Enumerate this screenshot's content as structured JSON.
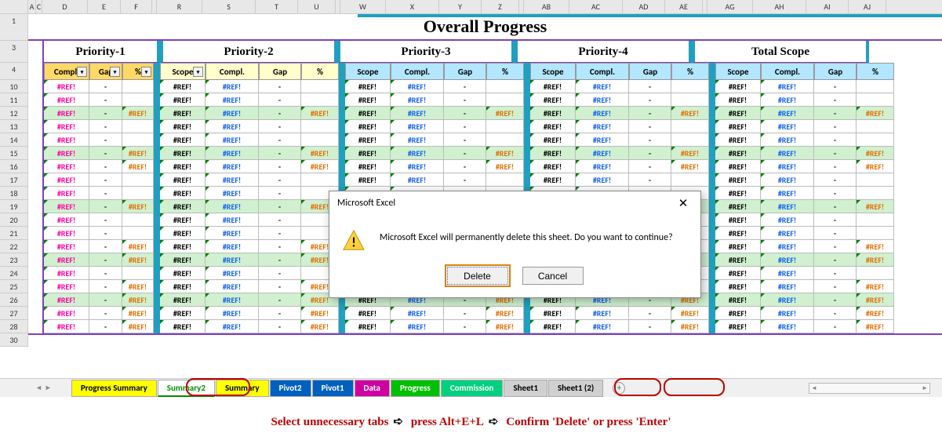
{
  "title": "Overall Progress",
  "sections": [
    "Priority-1",
    "Priority-2",
    "Priority-3",
    "Priority-4",
    "Total Scope"
  ],
  "col_headers_ruler": [
    "A",
    "C",
    "D",
    "E",
    "F",
    "R",
    "S",
    "T",
    "U",
    "W",
    "X",
    "Y",
    "Z",
    "AB",
    "AC",
    "AD",
    "AE",
    "AG",
    "AH",
    "AI",
    "AJ"
  ],
  "p1_headers": [
    "Compl.",
    "Gap",
    "%"
  ],
  "group_headers": [
    "Scope",
    "Compl.",
    "Gap",
    "%"
  ],
  "row_nums": [
    "1",
    "3",
    "4",
    "10",
    "11",
    "12",
    "13",
    "14",
    "15",
    "16",
    "17",
    "18",
    "19",
    "20",
    "21",
    "22",
    "23",
    "24",
    "25",
    "26",
    "27",
    "28",
    "30"
  ],
  "ref": "#REF!",
  "dash": "-",
  "greens": [
    12,
    15,
    19,
    23,
    26
  ],
  "orange_pct_rows": [
    12,
    15,
    16,
    19,
    22,
    23,
    25,
    26,
    27,
    28
  ],
  "tabs": [
    {
      "label": "Progress Summary",
      "cls": "yellow"
    },
    {
      "label": "Summary2",
      "cls": "sel-green"
    },
    {
      "label": "Summary",
      "cls": "yellow"
    },
    {
      "label": "Pivot2",
      "cls": "blue"
    },
    {
      "label": "Pivot1",
      "cls": "blue"
    },
    {
      "label": "Data",
      "cls": "magenta"
    },
    {
      "label": "Progress",
      "cls": "green"
    },
    {
      "label": "Commission",
      "cls": "teal"
    },
    {
      "label": "Sheet1",
      "cls": "grey"
    },
    {
      "label": "Sheet1 (2)",
      "cls": "grey"
    }
  ],
  "dialog": {
    "title": "Microsoft Excel",
    "message": "Microsoft Excel will permanently delete this sheet. Do you want to continue?",
    "delete": "Delete",
    "cancel": "Cancel"
  },
  "instruction": {
    "p1": "Select unnecessary tabs",
    "p2": "press Alt+E+L",
    "p3": "Confirm 'Delete' or press 'Enter'"
  },
  "chart_data": {
    "type": "table",
    "title": "Overall Progress",
    "note": "All data cells display the #REF! error; Gap columns display '-'. Rows 12,15,19,23,26 are highlighted green. % column populated with #REF! on rows 12,15,16,19,22,23,25,26,27,28.",
    "columns_per_priority": [
      "Scope",
      "Compl.",
      "Gap",
      "%"
    ],
    "priorities": [
      "Priority-1",
      "Priority-2",
      "Priority-3",
      "Priority-4",
      "Total Scope"
    ],
    "visible_data_rows": [
      10,
      11,
      12,
      13,
      14,
      15,
      16,
      17,
      18,
      19,
      20,
      21,
      22,
      23,
      24,
      25,
      26,
      27,
      28
    ]
  }
}
